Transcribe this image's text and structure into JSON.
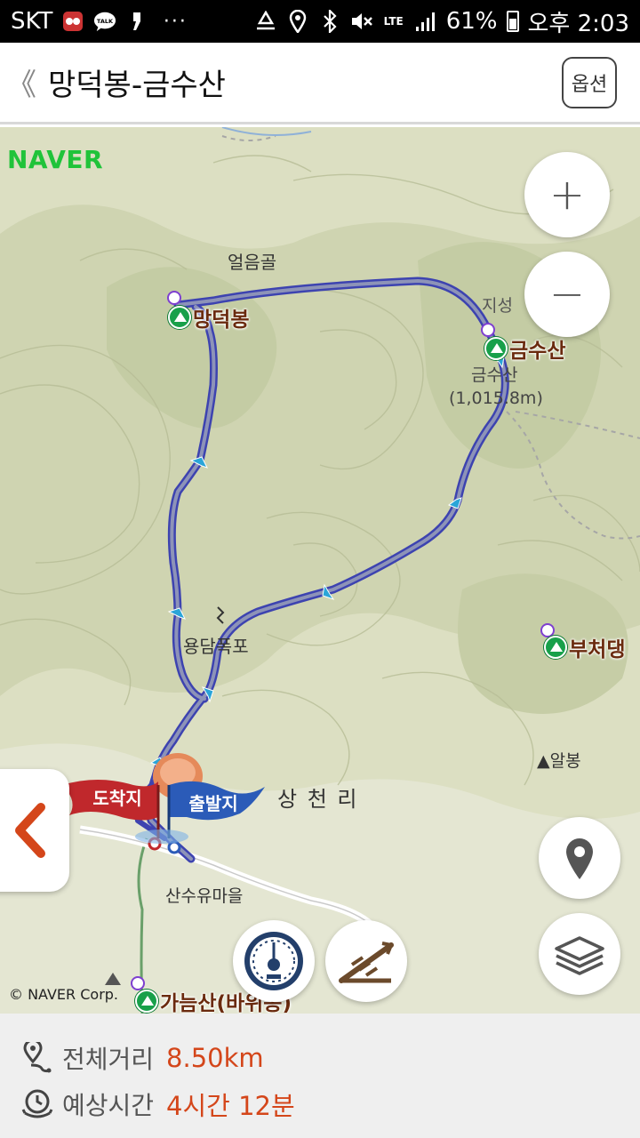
{
  "status_bar": {
    "carrier": "SKT",
    "network": "LTE",
    "battery": "61%",
    "time": "오후 2:03",
    "icons": [
      "game-icon",
      "talk-icon",
      "notification-icon",
      "more-icon",
      "recycle-icon",
      "location-icon",
      "bluetooth-icon",
      "mute-icon",
      "lte-icon",
      "signal-icon",
      "battery-icon"
    ]
  },
  "header": {
    "back_label": "《",
    "title": "망덕봉-금수산",
    "options_label": "옵션"
  },
  "map": {
    "logo": "NAVER",
    "copyright": "© NAVER Corp.",
    "labels": {
      "valley": "얼음골",
      "waterfall": "용담폭포",
      "village": "상 천 리",
      "village_stop": "산수유마을",
      "peak_elev_name": "금수산",
      "peak_elev_value": "(1,015.8m)",
      "albong": "▲알봉",
      "jiseong": "지성",
      "hidden_1": "망덕봉",
      "hidden_2": "가늠산"
    },
    "peaks": {
      "mangdeok": "망덕봉",
      "geumsu": "금수산",
      "bucheo": "부처댕",
      "ganeum": "가늠산(바위봉)"
    },
    "flags": {
      "arrival": "도착지",
      "departure": "출발지"
    },
    "zoom_in": "+",
    "zoom_out": "−"
  },
  "route_info": {
    "distance_label": "전체거리",
    "distance_value": "8.50km",
    "time_label": "예상시간",
    "time_value": "4시간 12분"
  },
  "colors": {
    "route": "#3d43b0",
    "accent_text": "#d4461a",
    "peak_green": "#18a04a",
    "arrival_flag": "#c0282c",
    "departure_flag": "#2b5bb8",
    "naver_green": "#20c33a"
  }
}
